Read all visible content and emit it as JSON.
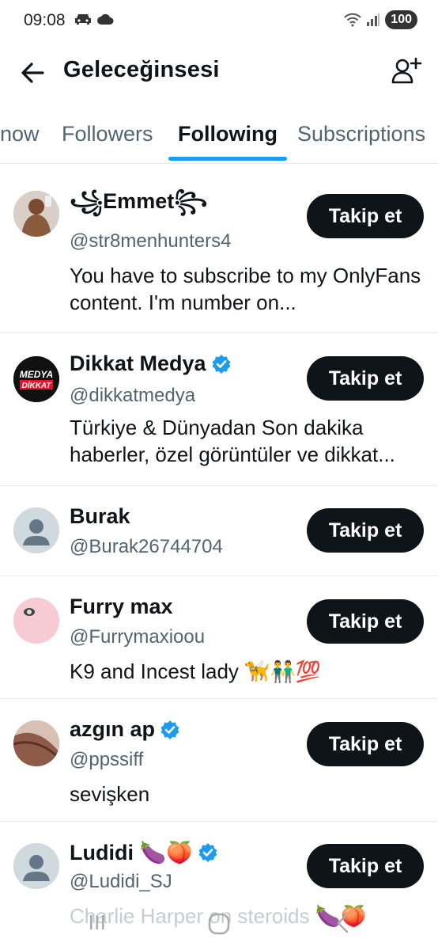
{
  "status_bar": {
    "time": "09:08",
    "battery": "100",
    "network": "5"
  },
  "header": {
    "title": "Geleceğinsesi"
  },
  "tabs": [
    {
      "label": "now"
    },
    {
      "label": "Followers"
    },
    {
      "label": "Following"
    },
    {
      "label": "Subscriptions"
    }
  ],
  "users": [
    {
      "name": "꧁Emmet꧂",
      "handle": "@str8menhunters4",
      "bio": "You have to subscribe to my OnlyFans content. I'm number on...",
      "follow_label": "Takip et",
      "verified": false
    },
    {
      "name": "Dikkat Medya",
      "handle": "@dikkatmedya",
      "bio": "Türkiye & Dünyadan Son dakika haberler, özel görüntüler ve dikkat...",
      "follow_label": "Takip et",
      "verified": true,
      "avatar_text_top": "MEDYA",
      "avatar_text_bottom": "DİKKAT"
    },
    {
      "name": "Burak",
      "handle": "@Burak26744704",
      "bio": "",
      "follow_label": "Takip et",
      "verified": false
    },
    {
      "name": "Furry max",
      "handle": "@Furrymaxioou",
      "bio": "K9 and Incest lady 🦮👬💯",
      "follow_label": "Takip et",
      "verified": false
    },
    {
      "name": "azgın ap",
      "handle": "@ppssiff",
      "bio": "sevişken",
      "follow_label": "Takip et",
      "verified": true
    },
    {
      "name": "Ludidi 🍆🍑",
      "handle": "@Ludidi_SJ",
      "bio": "Charlie Harper on steroids 🍆🍑",
      "follow_label": "Takip et",
      "verified": true
    }
  ],
  "colors": {
    "accent": "#1d9bf0",
    "button_bg": "#0f1419",
    "muted": "#536471"
  }
}
